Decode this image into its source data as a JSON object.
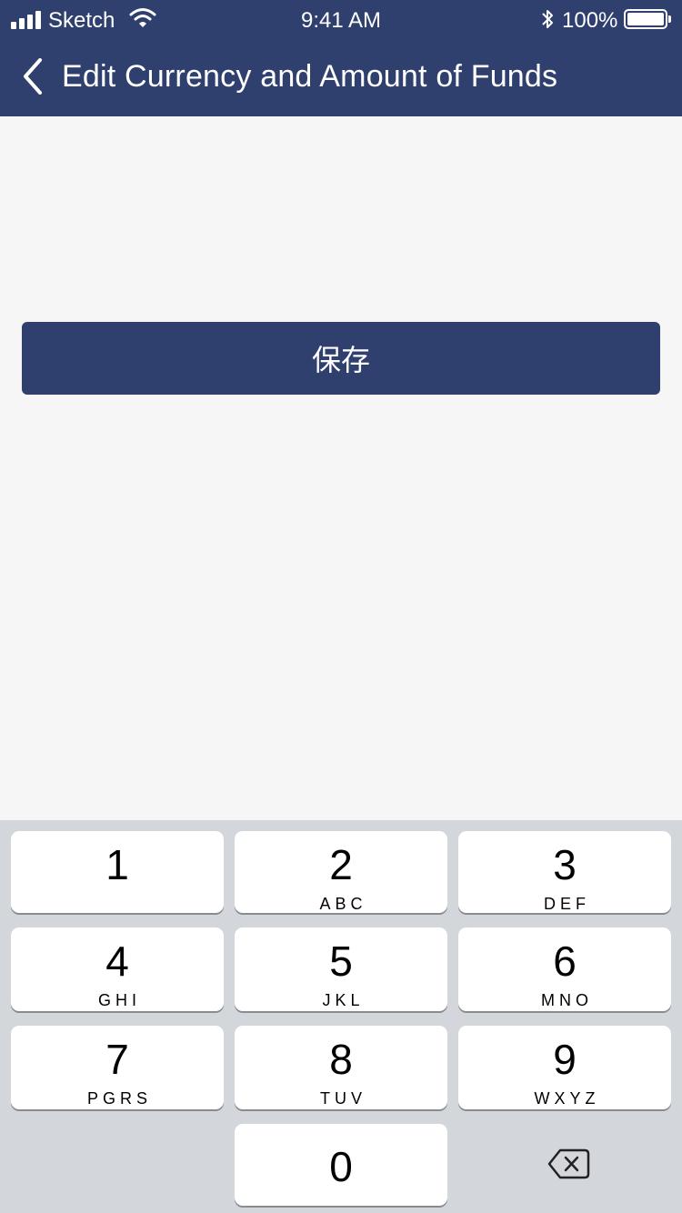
{
  "status_bar": {
    "carrier": "Sketch",
    "time": "9:41 AM",
    "battery": "100%",
    "battery_level": 1.0,
    "icons": [
      "signal-icon",
      "wifi-icon",
      "bluetooth-icon",
      "battery-icon"
    ]
  },
  "nav": {
    "back_icon": "chevron-left-icon",
    "title": "Edit Currency and Amount of Funds"
  },
  "main": {
    "save_label": "保存"
  },
  "keypad": {
    "keys": [
      {
        "digit": "1",
        "letters": ""
      },
      {
        "digit": "2",
        "letters": "ABC"
      },
      {
        "digit": "3",
        "letters": "DEF"
      },
      {
        "digit": "4",
        "letters": "GHI"
      },
      {
        "digit": "5",
        "letters": "JKL"
      },
      {
        "digit": "6",
        "letters": "MNO"
      },
      {
        "digit": "7",
        "letters": "PGRS"
      },
      {
        "digit": "8",
        "letters": "TUV"
      },
      {
        "digit": "9",
        "letters": "WXYZ"
      },
      {
        "digit": "0",
        "letters": ""
      }
    ],
    "delete_icon": "backspace-icon"
  },
  "colors": {
    "primary": "#2f3f6e",
    "background": "#f6f6f6",
    "keypad_bg": "#d3d6db"
  }
}
